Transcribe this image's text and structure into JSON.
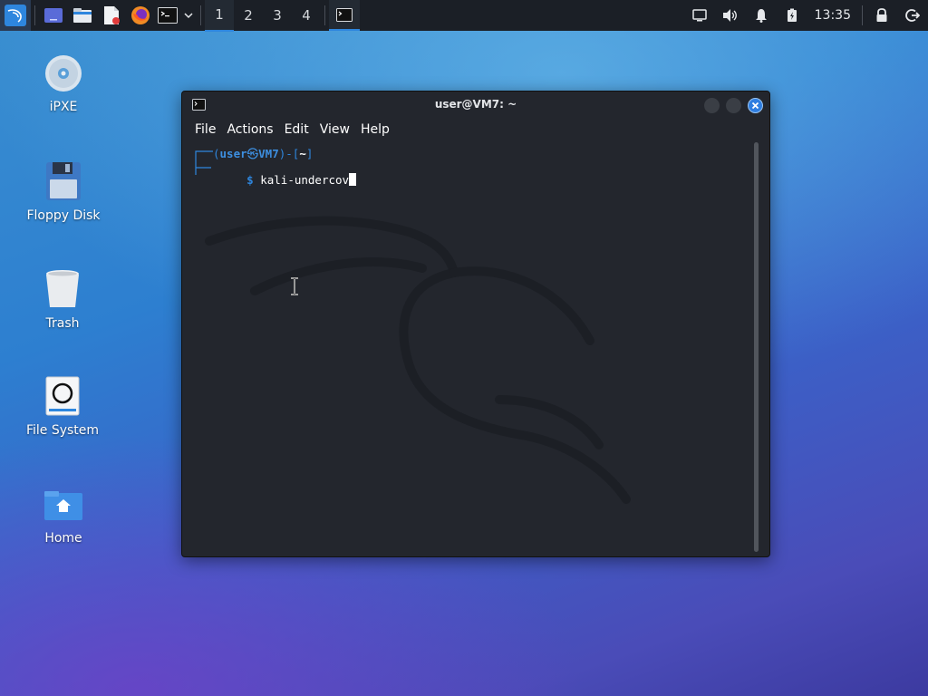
{
  "panel": {
    "workspaces": [
      "1",
      "2",
      "3",
      "4"
    ],
    "active_workspace": "1",
    "clock": "13:35"
  },
  "desktop": {
    "icons": [
      {
        "label": "iPXE"
      },
      {
        "label": "Floppy Disk"
      },
      {
        "label": "Trash"
      },
      {
        "label": "File System"
      },
      {
        "label": "Home"
      }
    ]
  },
  "terminal": {
    "title": "user@VM7: ~",
    "menu": [
      "File",
      "Actions",
      "Edit",
      "View",
      "Help"
    ],
    "prompt": {
      "user": "user",
      "host": "VM7",
      "dir": "~",
      "symbol": "$",
      "command": "kali-undercov"
    }
  },
  "colors": {
    "panel_bg": "#1b1f26",
    "accent": "#2e86de",
    "terminal_bg": "#23262d",
    "prompt_user": "#3d8fe0",
    "close_button": "#2f7ee0"
  }
}
